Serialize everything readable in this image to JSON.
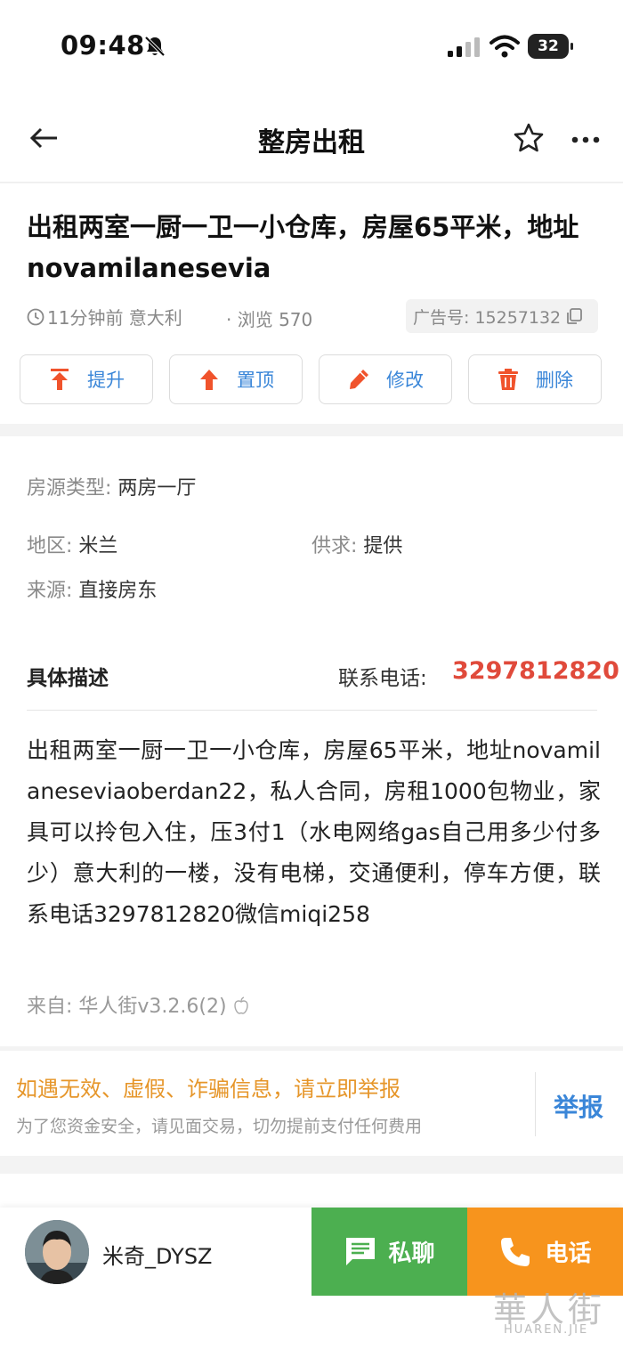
{
  "status_bar": {
    "time": "09:48",
    "battery": "32"
  },
  "nav": {
    "title": "整房出租"
  },
  "post": {
    "title": "出租两室一厨一卫一小仓库，房屋65平米，地址novamilanesevia",
    "time_location": "11分钟前 意大利",
    "views": "· 浏览 570",
    "ad_number": "广告号: 15257132"
  },
  "actions": [
    {
      "label": "提升",
      "icon": "boost-icon"
    },
    {
      "label": "置顶",
      "icon": "pin-top-icon"
    },
    {
      "label": "修改",
      "icon": "edit-icon"
    },
    {
      "label": "删除",
      "icon": "trash-icon"
    }
  ],
  "details": {
    "type_label": "房源类型:",
    "type_value": "两房一厅",
    "region_label": "地区:",
    "region_value": "米兰",
    "supply_label": "供求:",
    "supply_value": "提供",
    "source_label": "来源:",
    "source_value": "直接房东"
  },
  "description": {
    "heading": "具体描述",
    "phone_label": "联系电话:",
    "phone_number": "3297812820",
    "body": "出租两室一厨一卫一小仓库，房屋65平米，地址novamilaneseviaoberdan22，私人合同，房租1000包物业，家具可以拎包入住，压3付1（水电网络gas自己用多少付多少）意大利的一楼，没有电梯，交通便利，停车方便，联系电话3297812820微信miqi258",
    "from": "来自: 华人街v3.2.6(2)"
  },
  "report": {
    "warning": "如遇无效、虚假、诈骗信息，请立即举报",
    "tip": "为了您资金安全，请见面交易，切勿提前支付任何费用",
    "button": "举报"
  },
  "bottom": {
    "user_name": "米奇_DYSZ",
    "chat_label": "私聊",
    "call_label": "电话"
  },
  "watermark": {
    "cn": "華人街",
    "en": "HUAREN.JIE"
  },
  "colors": {
    "accent_blue": "#3a86d8",
    "phone_red": "#e04a3b",
    "warn_orange": "#e6962a",
    "chat_green": "#4caf50",
    "call_orange": "#f7941d",
    "action_icon_red": "#f0532c"
  }
}
